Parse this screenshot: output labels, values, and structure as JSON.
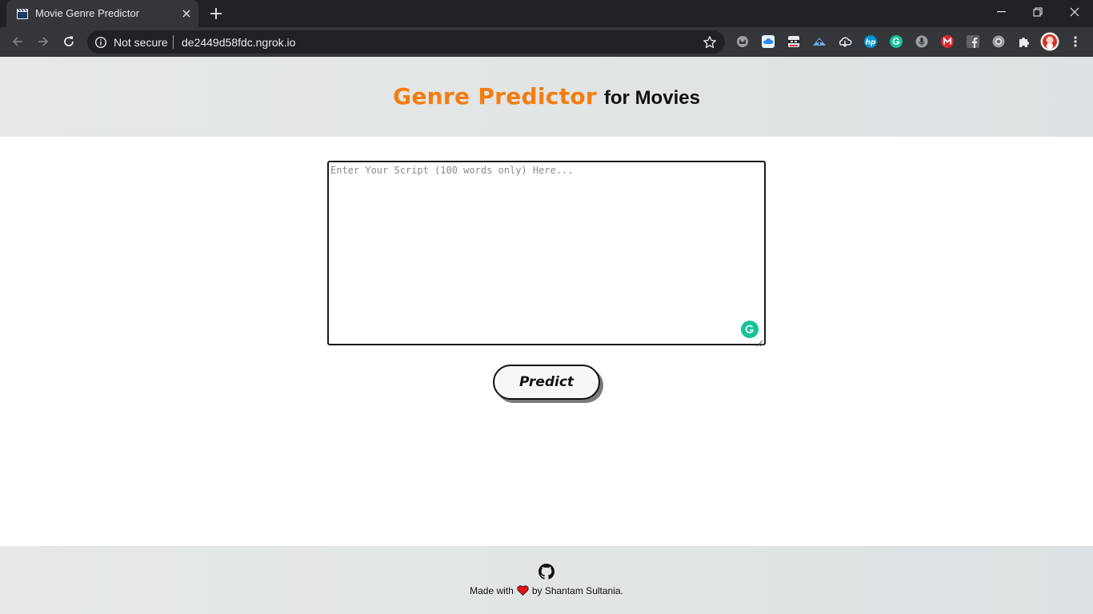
{
  "browser": {
    "tab_title": "Movie Genre Predictor",
    "security_label": "Not secure",
    "url": "de2449d58fdc.ngrok.io",
    "extensions": [
      "gmail-extension-icon",
      "cloud-extension-icon",
      "ninja-extension-icon",
      "upload-extension-icon",
      "download-extension-icon",
      "hp-extension-icon",
      "grammarly-extension-icon",
      "mic-extension-icon",
      "mega-extension-icon",
      "facebook-extension-icon",
      "record-extension-icon",
      "puzzle-icon",
      "profile-avatar",
      "kebab-menu-icon"
    ],
    "hp_label": "hp",
    "colors": {
      "tabbar": "#202124",
      "toolbar": "#35363a",
      "omnibox": "#202124"
    }
  },
  "header": {
    "title_accent": "Genre Predictor",
    "title_rest": "for Movies",
    "accent_color": "#f47c0f"
  },
  "main": {
    "script_placeholder": "Enter Your Script (100 words only) Here...",
    "script_value": "",
    "predict_label": "Predict"
  },
  "footer": {
    "made_with": "Made with",
    "by_text": "by Shantam Sultania.",
    "heart_color": "#e3101b"
  }
}
